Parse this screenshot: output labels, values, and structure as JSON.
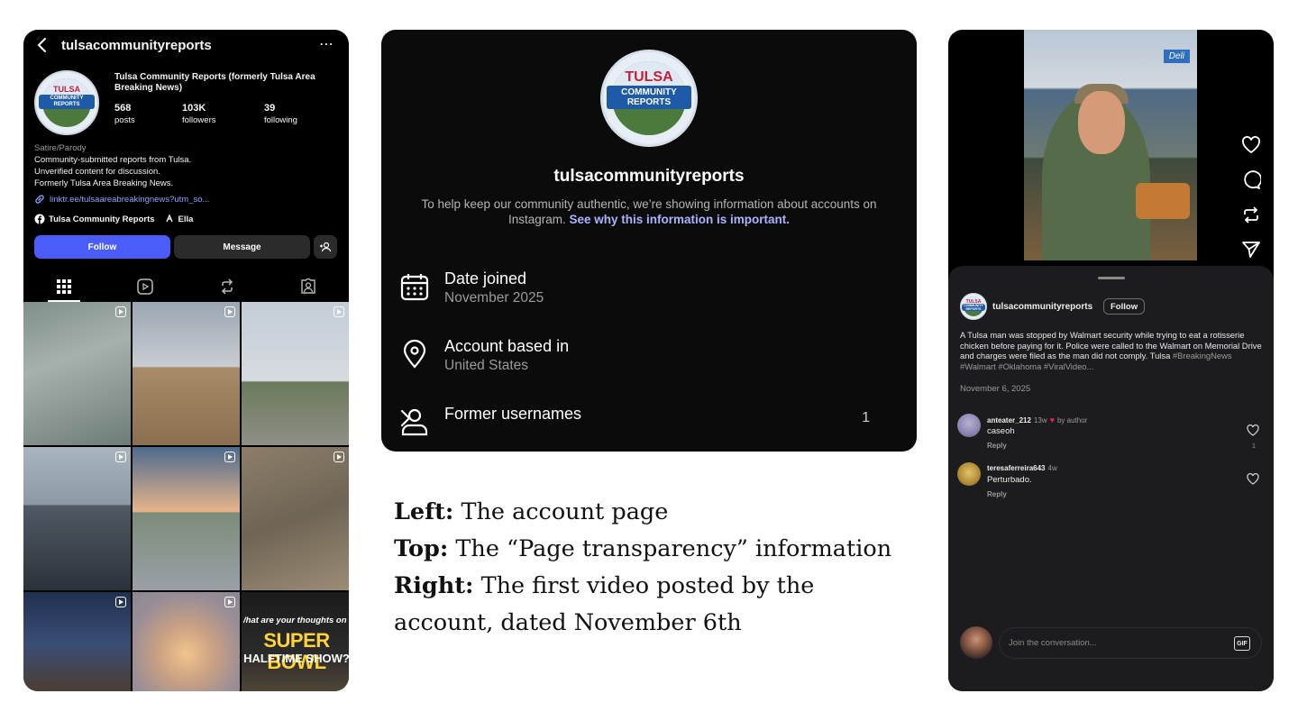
{
  "colors": {
    "accent_blue": "#4a5df9",
    "link_blue": "#a9b4ff",
    "heart_red": "#e0245e",
    "panel_bg": "#000000"
  },
  "left": {
    "handle": "tulsacommunityreports",
    "more_icon": "⋯",
    "full_name": "Tulsa Community Reports (formerly Tulsa Area Breaking News)",
    "stats": [
      {
        "num": "568",
        "label": "posts"
      },
      {
        "num": "103K",
        "label": "followers"
      },
      {
        "num": "39",
        "label": "following"
      }
    ],
    "bio": {
      "category": "Satire/Parody",
      "line1": "Community-submitted reports from Tulsa.",
      "line2": "Unverified content for discussion.",
      "line3": "Formerly Tulsa Area Breaking News."
    },
    "link": "linktr.ee/tulsaareabreakingnews?utm_so...",
    "chips": {
      "facebook": "Tulsa Community Reports",
      "threads": "Ella"
    },
    "buttons": {
      "follow": "Follow",
      "message": "Message"
    },
    "grid_overlay": {
      "line1": "/hat are your thoughts on the",
      "line2": "SUPER BOWL",
      "line3": "HALFTIME SHOW?"
    }
  },
  "logo": {
    "tulsa": "TULSA",
    "community": "COMMUNITY",
    "reports": "REPORTS"
  },
  "center": {
    "handle": "tulsacommunityreports",
    "notice": "To help keep our community authentic, we’re showing information about accounts on Instagram.",
    "notice_link": "See why this information is important.",
    "rows": [
      {
        "label": "Date joined",
        "sub": "November 2025",
        "icon": "calendar-icon"
      },
      {
        "label": "Account based in",
        "sub": "United States",
        "icon": "location-pin-icon"
      },
      {
        "label": "Former usernames",
        "count": "1",
        "icon": "person-icon"
      }
    ]
  },
  "caption": {
    "left_label": "Left:",
    "left_text": "The account page",
    "top_label": "Top:",
    "top_text": "The “Page transparency” information",
    "right_label": "Right:",
    "right_text": "The first video posted by the account, dated November 6th"
  },
  "right": {
    "video_sign": "Deli",
    "username": "tulsacommunityreports",
    "follow": "Follow",
    "description": "A Tulsa man was stopped by Walmart security while trying to eat a rotisserie chicken before paying for it. Police were called to the Walmart on Memorial Drive and charges were filed as the man did not comply. Tulsa",
    "hashtags": "#BreakingNews #Walmart #Oklahoma #ViralVideo...",
    "date": "November 6, 2025",
    "comments": [
      {
        "user": "anteater_212",
        "time": "13w",
        "by_author": "by author",
        "text": "caseoh",
        "reply": "Reply",
        "likes": "1"
      },
      {
        "user": "teresaferreira643",
        "time": "4w",
        "text": "Perturbado.",
        "reply": "Reply"
      }
    ],
    "input_placeholder": "Join the conversation...",
    "gif": "GIF"
  }
}
